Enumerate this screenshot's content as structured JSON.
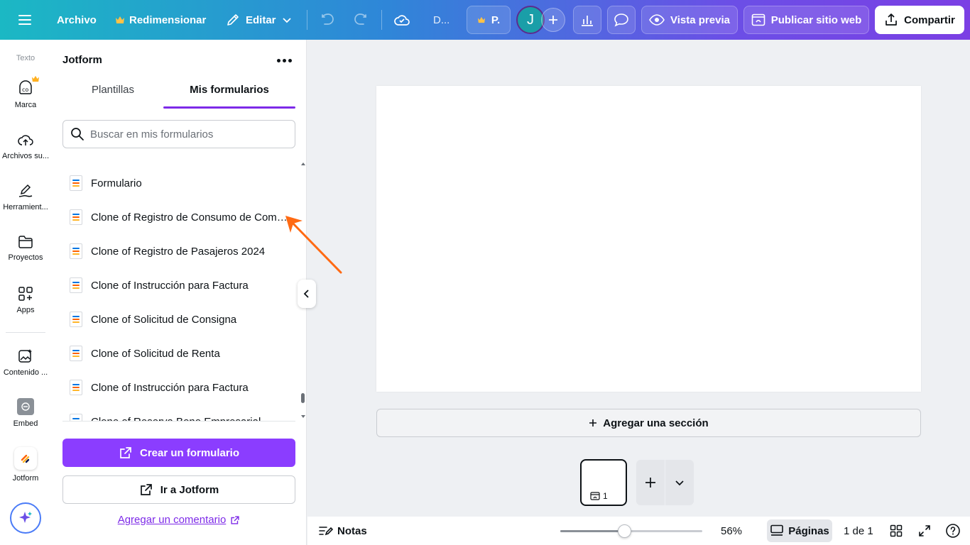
{
  "topbar": {
    "file_label": "Archivo",
    "resize_label": "Redimensionar",
    "edit_label": "Editar",
    "design_title": "D...",
    "pro_label": "P.",
    "avatar_initial": "J",
    "preview_label": "Vista previa",
    "publish_label": "Publicar sitio web",
    "share_label": "Compartir"
  },
  "rail": {
    "text_label": "Texto",
    "items": [
      {
        "label": "Marca",
        "icon": "brand-icon"
      },
      {
        "label": "Archivos su...",
        "icon": "cloud-upload-icon"
      },
      {
        "label": "Herramient...",
        "icon": "draw-tool-icon"
      },
      {
        "label": "Proyectos",
        "icon": "folder-icon"
      },
      {
        "label": "Apps",
        "icon": "apps-grid-icon"
      },
      {
        "label": "Contenido ...",
        "icon": "image-sparkle-icon"
      },
      {
        "label": "Embed",
        "icon": "embed-icon"
      },
      {
        "label": "Jotform",
        "icon": "jotform-icon"
      }
    ]
  },
  "panel": {
    "title": "Jotform",
    "tabs": [
      {
        "label": "Plantillas",
        "active": false
      },
      {
        "label": "Mis formularios",
        "active": true
      }
    ],
    "search_placeholder": "Buscar en mis formularios",
    "forms": [
      "Formulario",
      "Clone of Registro de Consumo de Combustible",
      "Clone of Registro de Pasajeros 2024",
      "Clone of Instrucción para Factura",
      "Clone of Solicitud de Consigna",
      "Clone of Solicitud de Renta",
      "Clone of Instrucción para Factura",
      "Clone of Reserva Bono Empresarial"
    ],
    "create_label": "Crear un formulario",
    "goto_label": "Ir a Jotform",
    "comment_label": "Agregar un comentario"
  },
  "canvas": {
    "add_section_label": "Agregar una sección",
    "page_number": "1"
  },
  "bottombar": {
    "notes_label": "Notas",
    "zoom_label": "56%",
    "zoom_fraction": 0.45,
    "pages_label": "Páginas",
    "page_count": "1 de 1"
  },
  "colors": {
    "accent": "#8b3dff",
    "tab_underline": "#7d2ae8",
    "annotation_arrow": "#ff6a13"
  }
}
